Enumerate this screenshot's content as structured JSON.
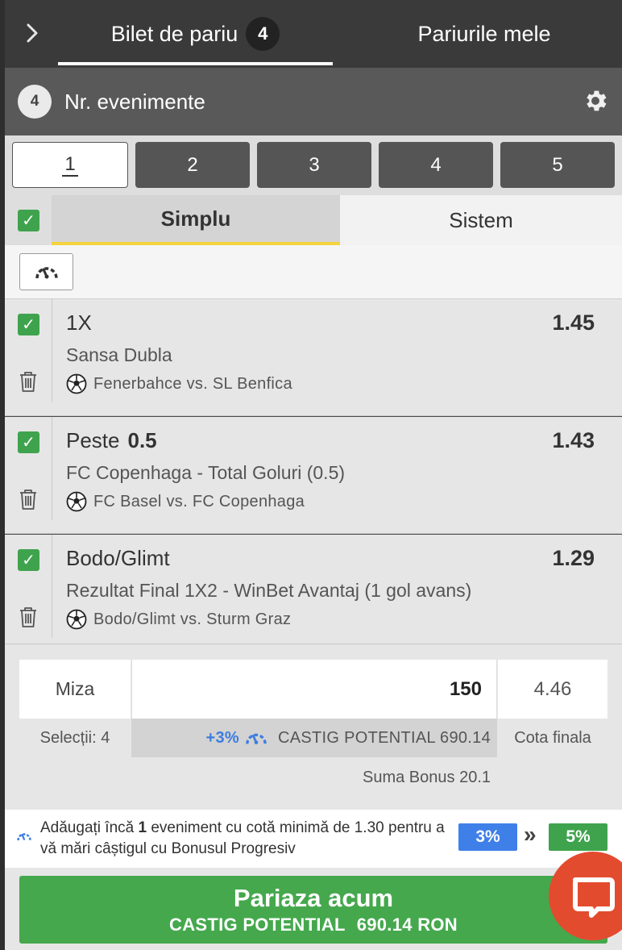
{
  "header": {
    "tab_bilet": "Bilet de pariu",
    "tab_bilet_badge": "4",
    "tab_mele": "Pariurile mele"
  },
  "events": {
    "count": "4",
    "label": "Nr. evenimente"
  },
  "selector": [
    "1",
    "2",
    "3",
    "4",
    "5"
  ],
  "modes": {
    "simplu": "Simplu",
    "sistem": "Sistem"
  },
  "selections": [
    {
      "pick": "1X",
      "line": "",
      "odd": "1.45",
      "market": "Sansa Dubla",
      "match": "Fenerbahce vs. SL Benfica"
    },
    {
      "pick": "Peste",
      "line": "0.5",
      "odd": "1.43",
      "market": "FC Copenhaga - Total Goluri (0.5)",
      "match": "FC Basel vs. FC Copenhaga"
    },
    {
      "pick": "Bodo/Glimt",
      "line": "",
      "odd": "1.29",
      "market": "Rezultat Final 1X2 - WinBet Avantaj (1 gol avans)",
      "match": "Bodo/Glimt vs. Sturm Graz"
    }
  ],
  "stake": {
    "miza_label": "Miza",
    "miza_value": "150",
    "cota_value": "4.46",
    "selectii": "Selecții: 4",
    "bonus_pct": "+3%",
    "castig": "CASTIG POTENTIAL 690.14",
    "cota_label": "Cota finala",
    "bonus_sum": "Suma Bonus 20.1"
  },
  "progressive": {
    "text_a": "Adăugați încă ",
    "text_bold": "1",
    "text_b": " eveniment cu cotă minimă de 1.30 pentru a vă mări câștigul cu Bonusul Progresiv",
    "from_pct": "3%",
    "arrows": "»",
    "to_pct": "5%"
  },
  "cta": {
    "line1": "Pariaza acum",
    "line2_label": "CASTIG POTENTIAL",
    "line2_amount": "690.14 RON"
  },
  "colors": {
    "green": "#45a84d",
    "blue": "#3f7fe8",
    "yellow_underline": "#f5d33e",
    "chat_red": "#e34b2f"
  }
}
